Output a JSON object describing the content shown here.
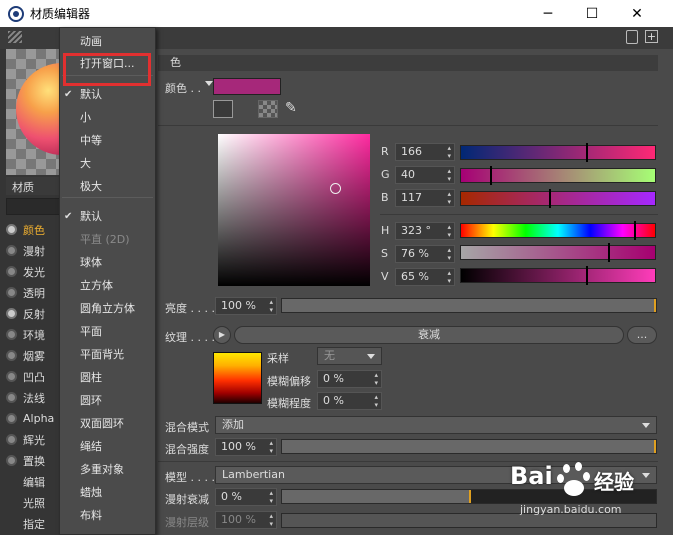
{
  "window": {
    "title": "材质编辑器",
    "minimize_glyph": "─",
    "maximize_glyph": "☐",
    "close_glyph": "✕"
  },
  "left": {
    "material_label": "材质",
    "channels": [
      {
        "label": "颜色",
        "radio": true,
        "on": true,
        "active": true
      },
      {
        "label": "漫射",
        "radio": true,
        "on": false
      },
      {
        "label": "发光",
        "radio": true,
        "on": false
      },
      {
        "label": "透明",
        "radio": true,
        "on": false
      },
      {
        "label": "反射",
        "radio": true,
        "on": true
      },
      {
        "label": "环境",
        "radio": true,
        "on": false
      },
      {
        "label": "烟雾",
        "radio": true,
        "on": false
      },
      {
        "label": "凹凸",
        "radio": true,
        "on": false
      },
      {
        "label": "法线",
        "radio": true,
        "on": false
      },
      {
        "label": "Alpha",
        "radio": true,
        "on": false
      },
      {
        "label": "辉光",
        "radio": true,
        "on": false
      },
      {
        "label": "置换",
        "radio": true,
        "on": false
      },
      {
        "label": "编辑",
        "radio": false
      },
      {
        "label": "光照",
        "radio": false
      },
      {
        "label": "指定",
        "radio": false
      }
    ]
  },
  "menu": {
    "items": [
      {
        "label": "动画",
        "checked": false,
        "disabled": false
      },
      {
        "label": "打开窗口...",
        "checked": false,
        "disabled": false
      },
      {
        "label": "默认",
        "checked": true,
        "disabled": false
      },
      {
        "label": "小",
        "checked": false,
        "disabled": false
      },
      {
        "label": "中等",
        "checked": false,
        "disabled": false
      },
      {
        "label": "大",
        "checked": false,
        "disabled": false
      },
      {
        "label": "极大",
        "checked": false,
        "disabled": false
      },
      {
        "label": "默认",
        "checked": true,
        "disabled": false
      },
      {
        "label": "平直 (2D)",
        "checked": false,
        "disabled": true
      },
      {
        "label": "球体",
        "checked": false,
        "disabled": false
      },
      {
        "label": "立方体",
        "checked": false,
        "disabled": false
      },
      {
        "label": "圆角立方体",
        "checked": false,
        "disabled": false
      },
      {
        "label": "平面",
        "checked": false,
        "disabled": false
      },
      {
        "label": "平面背光",
        "checked": false,
        "disabled": false
      },
      {
        "label": "圆柱",
        "checked": false,
        "disabled": false
      },
      {
        "label": "圆环",
        "checked": false,
        "disabled": false
      },
      {
        "label": "双面圆环",
        "checked": false,
        "disabled": false
      },
      {
        "label": "绳结",
        "checked": false,
        "disabled": false
      },
      {
        "label": "多重对象",
        "checked": false,
        "disabled": false
      },
      {
        "label": "蜡烛",
        "checked": false,
        "disabled": false
      },
      {
        "label": "布料",
        "checked": false,
        "disabled": false
      }
    ]
  },
  "color": {
    "section_title": "色",
    "color_label": "颜色 . .",
    "swatch_hex": "#a6287a",
    "R": {
      "label": "R",
      "value": "166"
    },
    "G": {
      "label": "G",
      "value": "40"
    },
    "B": {
      "label": "B",
      "value": "117"
    },
    "H": {
      "label": "H",
      "value": "323 °"
    },
    "S": {
      "label": "S",
      "value": "76 %"
    },
    "V": {
      "label": "V",
      "value": "65 %"
    },
    "brightness": {
      "label": "亮度 . . . .",
      "value": "100 %"
    },
    "texture": {
      "label": "纹理 . . . .",
      "shader": "衰减",
      "more": "..."
    },
    "sampling": {
      "label": "采样",
      "value": "无"
    },
    "blur_offset": {
      "label": "模糊偏移",
      "value": "0 %"
    },
    "blur_scale": {
      "label": "模糊程度",
      "value": "0 %"
    },
    "mix_mode": {
      "label": "混合模式",
      "value": "添加"
    },
    "mix_strength": {
      "label": "混合强度",
      "value": "100 %"
    },
    "model": {
      "label": "模型 . . . .",
      "value": "Lambertian"
    },
    "diffuse_falloff": {
      "label": "漫射衰减",
      "value": "0 %"
    },
    "diffuse_level": {
      "label": "漫射层级",
      "value": "100 %"
    }
  },
  "watermark": {
    "brand": "Bai",
    "brand2": "经验",
    "url": "jingyan.baidu.com"
  }
}
